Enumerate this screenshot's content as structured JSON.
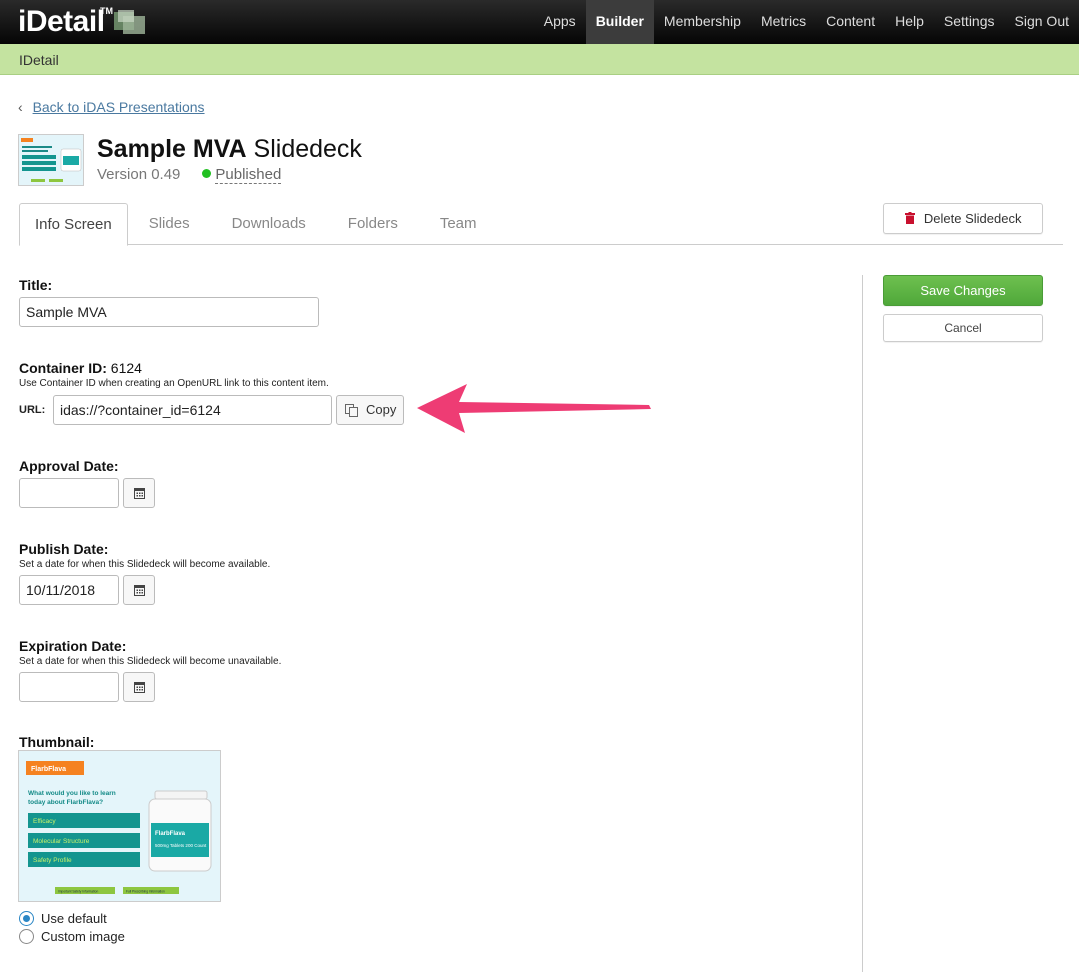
{
  "app": {
    "logo_text": "iDetail",
    "logo_tm": "TM"
  },
  "nav": [
    {
      "label": "Apps"
    },
    {
      "label": "Builder",
      "active": true
    },
    {
      "label": "Membership"
    },
    {
      "label": "Metrics"
    },
    {
      "label": "Content"
    },
    {
      "label": "Help"
    },
    {
      "label": "Settings"
    },
    {
      "label": "Sign Out"
    }
  ],
  "subbar": {
    "title": "IDetail"
  },
  "back_link": "Back to iDAS Presentations",
  "header": {
    "title_bold": "Sample MVA",
    "title_light": "Slidedeck",
    "version": "Version 0.49",
    "status": "Published",
    "status_color": "#22c022"
  },
  "tabs": [
    "Info Screen",
    "Slides",
    "Downloads",
    "Folders",
    "Team"
  ],
  "actions": {
    "delete": "Delete Slidedeck",
    "save": "Save Changes",
    "cancel": "Cancel"
  },
  "form": {
    "title_label": "Title:",
    "title_value": "Sample MVA",
    "container_label": "Container ID:",
    "container_id": "6124",
    "container_hint": "Use Container ID when creating an OpenURL link to this content item.",
    "url_label": "URL:",
    "url_value": "idas://?container_id=6124",
    "copy_label": "Copy",
    "approval_label": "Approval Date:",
    "approval_value": "",
    "publish_label": "Publish Date:",
    "publish_hint": "Set a date for when this Slidedeck will become available.",
    "publish_value": "10/11/2018",
    "expiration_label": "Expiration Date:",
    "expiration_hint": "Set a date for when this Slidedeck will become unavailable.",
    "expiration_value": "",
    "thumbnail_label": "Thumbnail:",
    "thumb_options": [
      "Use default",
      "Custom image"
    ],
    "thumb_selected": "Use default"
  },
  "thumbnail": {
    "brand": "FlarbFlava",
    "question": "What would you like to learn today about FlarbFlava?",
    "buttons": [
      "Efficacy",
      "Molecular Structure",
      "Safety Profile"
    ],
    "bottle_brand": "FlarbFlava",
    "bottle_text": "500mg Tablets 200 Count",
    "footer_links": [
      "Important Safety Information",
      "Full Prescribing Information"
    ]
  },
  "colors": {
    "accent_green": "#c4e3a0",
    "save_green": "#5cb346",
    "link_blue": "#4a79a0",
    "arrow_pink": "#ee3c74",
    "delete_red": "#c8102e",
    "thumb_teal": "#13958f",
    "thumb_orange": "#f58220"
  },
  "icons": [
    "calendar-icon",
    "copy-icon",
    "trash-icon",
    "chevron-left-icon"
  ]
}
